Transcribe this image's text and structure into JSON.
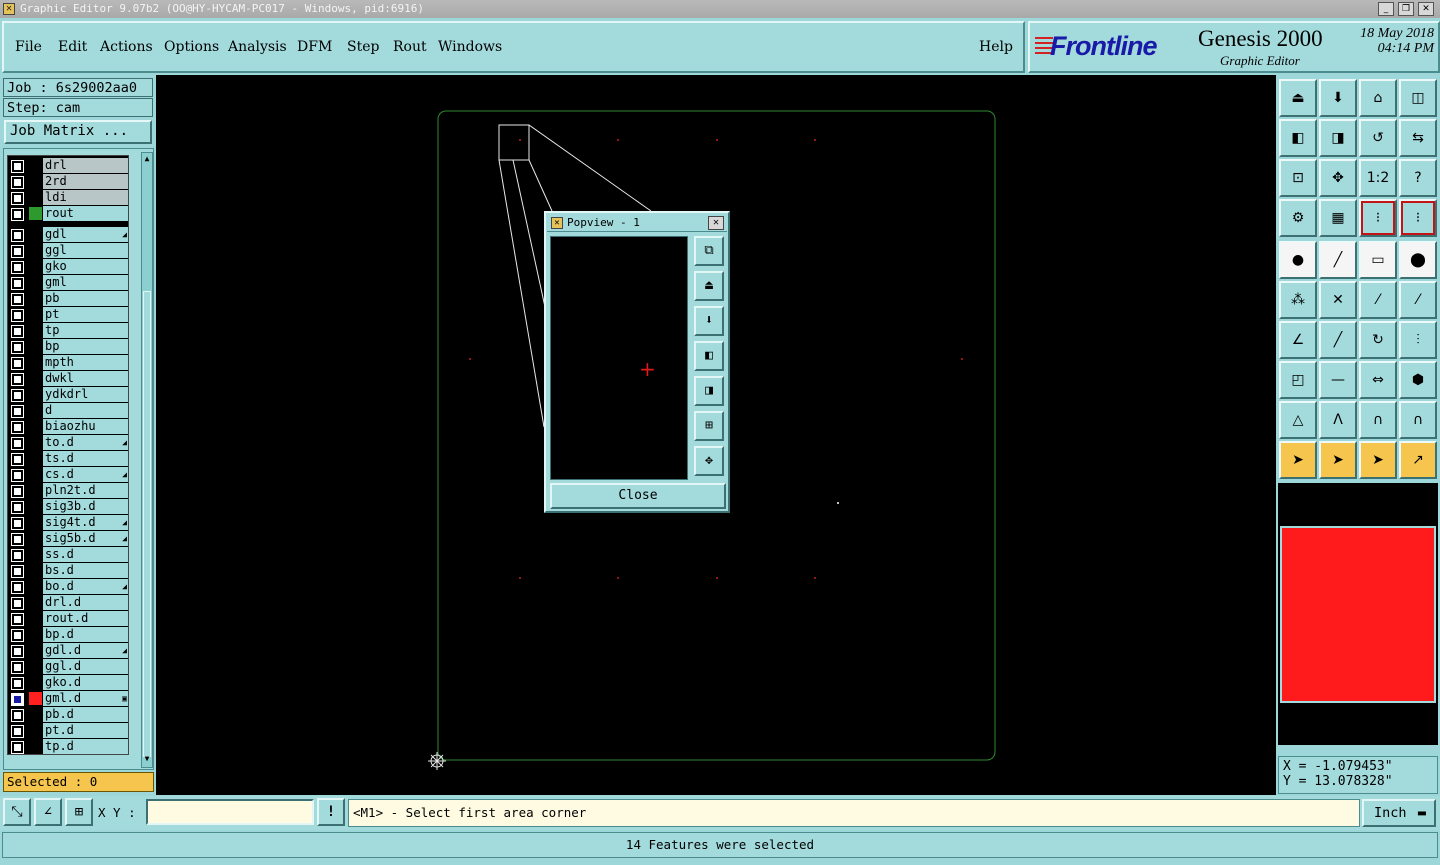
{
  "window": {
    "title": "Graphic Editor 9.07b2 (OO@HY-HYCAM-PC017 - Windows, pid:6916)",
    "controls": [
      "minimize",
      "maximize",
      "close"
    ]
  },
  "menubar": {
    "items": [
      "File",
      "Edit",
      "Actions",
      "Options",
      "Analysis",
      "DFM",
      "Step",
      "Rout",
      "Windows"
    ],
    "help": "Help"
  },
  "logo": {
    "brand": "Frontline",
    "product": "Genesis 2000",
    "module": "Graphic Editor",
    "date": "18 May 2018",
    "time": "04:14 PM"
  },
  "job": {
    "job_label": "Job : 6s29002aa0",
    "step_label": "Step: cam",
    "matrix_button": "Job Matrix ..."
  },
  "layers": [
    {
      "name": "drl",
      "grey": true,
      "color": "",
      "mark": ""
    },
    {
      "name": "2rd",
      "grey": true,
      "color": "",
      "mark": ""
    },
    {
      "name": "ldi",
      "grey": true,
      "color": "",
      "mark": ""
    },
    {
      "name": "rout",
      "grey": false,
      "color": "#2e9a2e",
      "mark": ""
    },
    {
      "name": "gdl",
      "grey": false,
      "color": "",
      "mark": "◢"
    },
    {
      "name": "ggl",
      "grey": false,
      "color": "",
      "mark": ""
    },
    {
      "name": "gko",
      "grey": false,
      "color": "",
      "mark": ""
    },
    {
      "name": "gml",
      "grey": false,
      "color": "",
      "mark": ""
    },
    {
      "name": "pb",
      "grey": false,
      "color": "",
      "mark": ""
    },
    {
      "name": "pt",
      "grey": false,
      "color": "",
      "mark": ""
    },
    {
      "name": "tp",
      "grey": false,
      "color": "",
      "mark": ""
    },
    {
      "name": "bp",
      "grey": false,
      "color": "",
      "mark": ""
    },
    {
      "name": "mpth",
      "grey": false,
      "color": "",
      "mark": ""
    },
    {
      "name": "dwkl",
      "grey": false,
      "color": "",
      "mark": ""
    },
    {
      "name": "ydkdrl",
      "grey": false,
      "color": "",
      "mark": ""
    },
    {
      "name": "d",
      "grey": false,
      "color": "",
      "mark": ""
    },
    {
      "name": "biaozhu",
      "grey": false,
      "color": "",
      "mark": ""
    },
    {
      "name": "to.d",
      "grey": false,
      "color": "",
      "mark": "◢"
    },
    {
      "name": "ts.d",
      "grey": false,
      "color": "",
      "mark": ""
    },
    {
      "name": "cs.d",
      "grey": false,
      "color": "",
      "mark": "◢"
    },
    {
      "name": "pln2t.d",
      "grey": false,
      "color": "",
      "mark": ""
    },
    {
      "name": "sig3b.d",
      "grey": false,
      "color": "",
      "mark": ""
    },
    {
      "name": "sig4t.d",
      "grey": false,
      "color": "",
      "mark": "◢"
    },
    {
      "name": "sig5b.d",
      "grey": false,
      "color": "",
      "mark": "◢"
    },
    {
      "name": "ss.d",
      "grey": false,
      "color": "",
      "mark": ""
    },
    {
      "name": "bs.d",
      "grey": false,
      "color": "",
      "mark": ""
    },
    {
      "name": "bo.d",
      "grey": false,
      "color": "",
      "mark": "◢"
    },
    {
      "name": "drl.d",
      "grey": false,
      "color": "",
      "mark": ""
    },
    {
      "name": "rout.d",
      "grey": false,
      "color": "",
      "mark": ""
    },
    {
      "name": "bp.d",
      "grey": false,
      "color": "",
      "mark": ""
    },
    {
      "name": "gdl.d",
      "grey": false,
      "color": "",
      "mark": "◢"
    },
    {
      "name": "ggl.d",
      "grey": false,
      "color": "",
      "mark": ""
    },
    {
      "name": "gko.d",
      "grey": false,
      "color": "",
      "mark": ""
    },
    {
      "name": "gml.d",
      "grey": false,
      "color": "#ff2020",
      "mark": "▣",
      "active": true
    },
    {
      "name": "pb.d",
      "grey": false,
      "color": "",
      "mark": ""
    },
    {
      "name": "pt.d",
      "grey": false,
      "color": "",
      "mark": ""
    },
    {
      "name": "tp.d",
      "grey": false,
      "color": "",
      "mark": ""
    }
  ],
  "selected_label": "Selected : 0",
  "popview": {
    "title": "Popview - 1",
    "close_label": "Close",
    "tools": [
      "zoom-window-icon",
      "pan-up-icon",
      "pan-down-icon",
      "pan-left-icon",
      "pan-right-icon",
      "zoom-in-icon",
      "zoom-out-icon"
    ]
  },
  "coords": {
    "x": "X = -1.079453\"",
    "y": "Y = 13.078328\""
  },
  "bottom": {
    "xy_label": "X Y :",
    "xy_value": "",
    "bang": "!",
    "prompt": "<M1> - Select first area corner",
    "unit": "Inch"
  },
  "status": "14 Features were selected",
  "colors": {
    "panel": "#a3dadc",
    "outline": "#2f8a2f",
    "highlight": "#ff1b1b",
    "selected_bg": "#f6c54d"
  }
}
